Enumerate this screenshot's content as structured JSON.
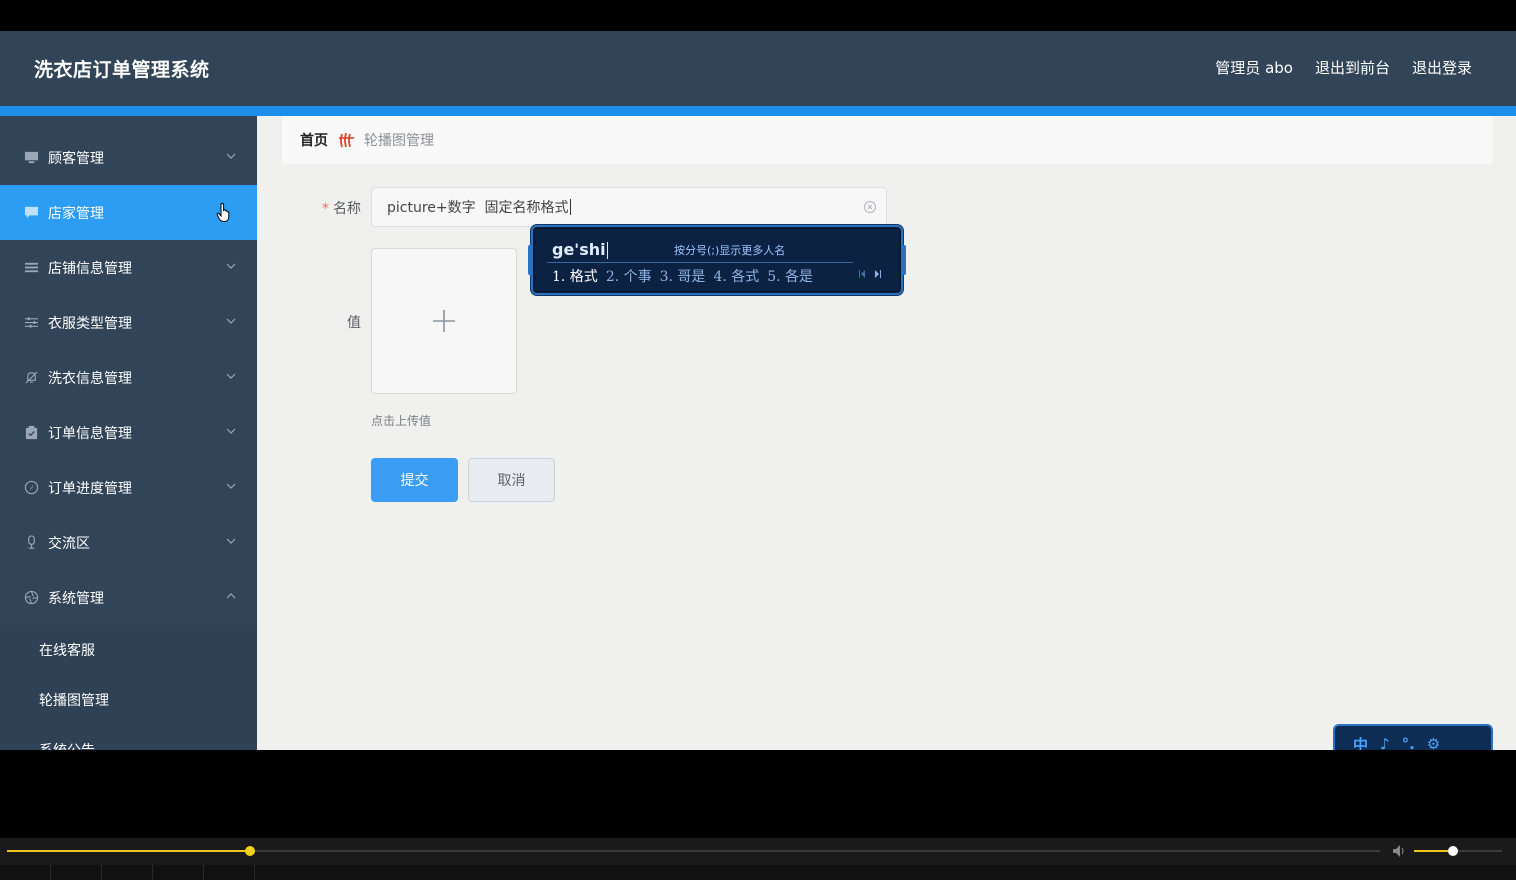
{
  "header": {
    "brand": "洗衣店订单管理系统",
    "admin_label": "管理员 abo",
    "to_front": "退出到前台",
    "logout": "退出登录"
  },
  "sidebar": {
    "items": [
      {
        "label": "顾客管理",
        "icon": "monitor-icon",
        "expanded": false
      },
      {
        "label": "店家管理",
        "icon": "chat-icon",
        "expanded": false,
        "active": true
      },
      {
        "label": "店铺信息管理",
        "icon": "list-icon",
        "expanded": false
      },
      {
        "label": "衣服类型管理",
        "icon": "sliders-icon",
        "expanded": false
      },
      {
        "label": "洗衣信息管理",
        "icon": "bell-off-icon",
        "expanded": false
      },
      {
        "label": "订单信息管理",
        "icon": "clipboard-icon",
        "expanded": false
      },
      {
        "label": "订单进度管理",
        "icon": "compass-icon",
        "expanded": false
      },
      {
        "label": "交流区",
        "icon": "microphone-icon",
        "expanded": false
      },
      {
        "label": "系统管理",
        "icon": "aperture-icon",
        "expanded": true
      }
    ],
    "sub_items": [
      "在线客服",
      "轮播图管理",
      "系统公告"
    ]
  },
  "breadcrumb": {
    "home": "首页",
    "current": "轮播图管理"
  },
  "form": {
    "name_label": "名称",
    "name_value": "picture+数字  固定名称格式",
    "value_label": "值",
    "upload_tip": "点击上传值",
    "submit": "提交",
    "cancel": "取消"
  },
  "ime": {
    "pinyin": "ge'shi",
    "hint": "按分号(;)显示更多人名",
    "candidates": [
      "1. 格式",
      "2. 个事",
      "3. 哥是",
      "4. 各式",
      "5. 各是"
    ]
  },
  "ime_toolbar": {
    "items": [
      "中",
      "♪",
      "°.",
      "⚙"
    ]
  },
  "player": {
    "progress": 0.177,
    "volume": 0.44
  },
  "colors": {
    "header_bg": "#324458",
    "accent": "#1d8fea",
    "active_item": "#2d9cf3",
    "primary_button": "#3a9cf2"
  }
}
